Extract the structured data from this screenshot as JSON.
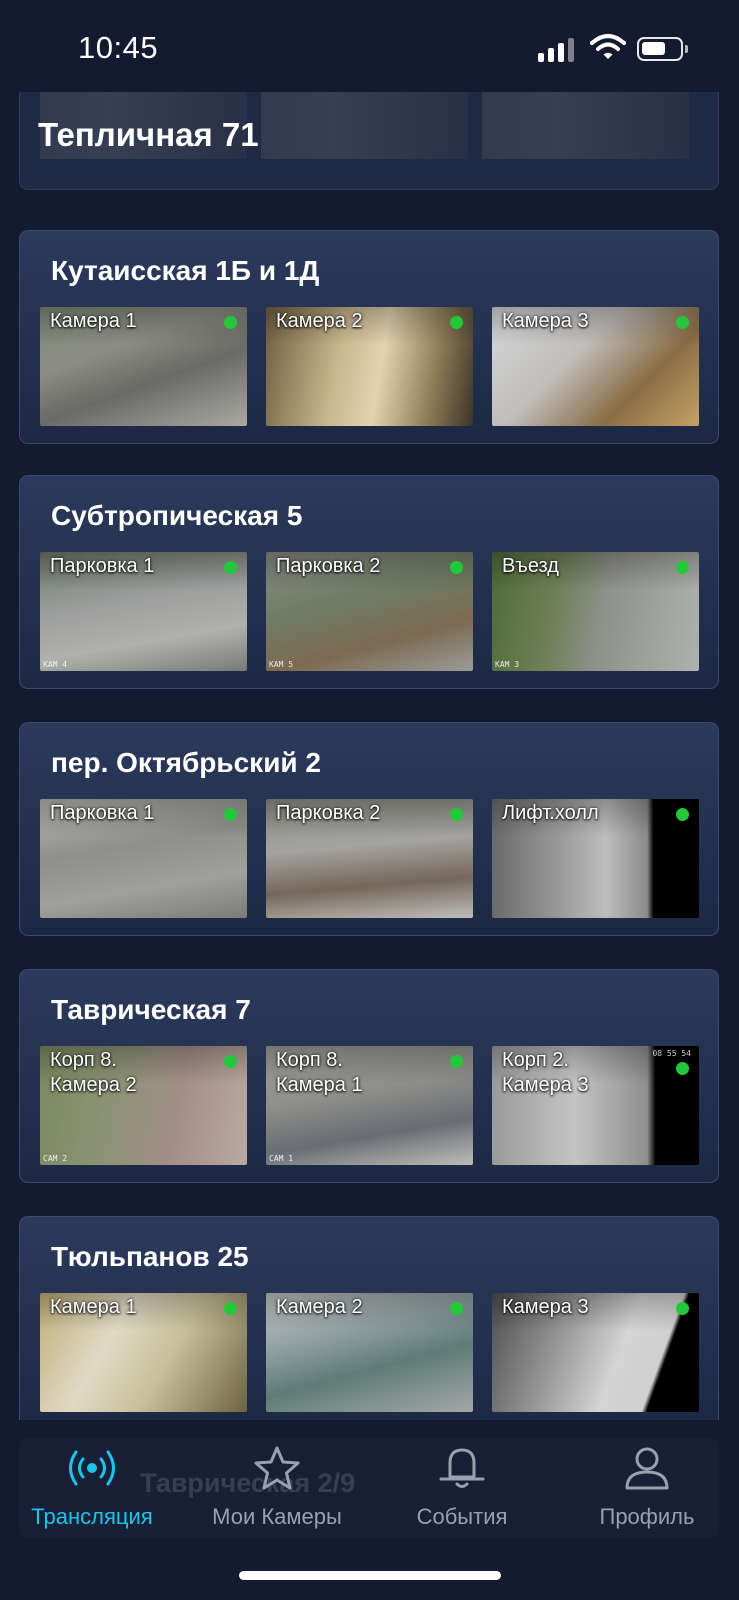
{
  "status_bar": {
    "time": "10:45"
  },
  "sticky_header": {
    "title": "Тепличная 71"
  },
  "accent_color": "#1ec4e8",
  "online_color": "#22c83a",
  "locations": [
    {
      "name": "Кутаисская 1Б и 1Д",
      "cameras": [
        {
          "label": "Камера 1",
          "online": true,
          "scene": "courtyard",
          "tag": "",
          "stamp": ""
        },
        {
          "label": "Камера 2",
          "online": true,
          "scene": "stairs",
          "tag": "",
          "stamp": ""
        },
        {
          "label": "Камера 3",
          "online": true,
          "scene": "cars",
          "tag": "",
          "stamp": ""
        }
      ]
    },
    {
      "name": "Субтропическая 5",
      "cameras": [
        {
          "label": "Парковка 1",
          "online": true,
          "scene": "parking",
          "tag": "КАМ 4",
          "stamp": ""
        },
        {
          "label": "Парковка 2",
          "online": true,
          "scene": "site",
          "tag": "КАМ 5",
          "stamp": ""
        },
        {
          "label": "Въезд",
          "online": true,
          "scene": "road",
          "tag": "КАМ 3",
          "stamp": ""
        }
      ]
    },
    {
      "name": "пер. Октябрьский 2",
      "cameras": [
        {
          "label": "Парковка 1",
          "online": true,
          "scene": "lot2",
          "tag": "",
          "stamp": ""
        },
        {
          "label": "Парковка 2",
          "online": true,
          "scene": "lot3",
          "tag": "",
          "stamp": ""
        },
        {
          "label": "Лифт.холл",
          "online": true,
          "scene": "lift",
          "tag": "",
          "stamp": ""
        }
      ]
    },
    {
      "name": "Таврическая 7",
      "cameras": [
        {
          "label": "Корп 8.\nКамера 2",
          "online": true,
          "scene": "wall",
          "tag": "CAM 2",
          "stamp": ""
        },
        {
          "label": "Корп 8.\nКамера 1",
          "online": true,
          "scene": "yard",
          "tag": "CAM 1",
          "stamp": ""
        },
        {
          "label": "Корп 2.\nКамера 3",
          "online": true,
          "scene": "gray",
          "tag": "",
          "stamp": "08 55 54"
        }
      ]
    },
    {
      "name": "Тюльпанов 25",
      "cameras": [
        {
          "label": "Камера 1",
          "online": true,
          "scene": "hall",
          "tag": "",
          "stamp": ""
        },
        {
          "label": "Камера 2",
          "online": true,
          "scene": "tile",
          "tag": "",
          "stamp": ""
        },
        {
          "label": "Камера 3",
          "online": true,
          "scene": "bikes",
          "tag": "",
          "stamp": ""
        }
      ]
    }
  ],
  "partially_hidden_text": "Таврическая 2/9",
  "tabs": [
    {
      "label": "Трансляция",
      "icon": "broadcast-icon",
      "active": true
    },
    {
      "label": "Мои Камеры",
      "icon": "star-icon",
      "active": false
    },
    {
      "label": "События",
      "icon": "bell-icon",
      "active": false
    },
    {
      "label": "Профиль",
      "icon": "person-icon",
      "active": false
    }
  ]
}
